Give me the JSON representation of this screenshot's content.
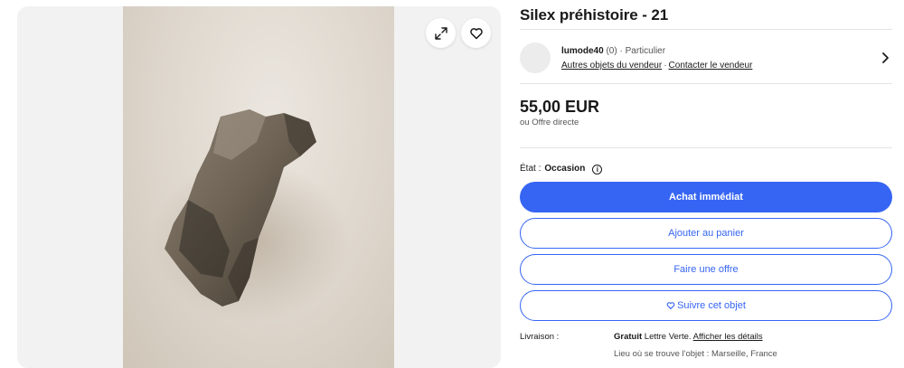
{
  "listing": {
    "title": "Silex préhistoire - 21"
  },
  "seller": {
    "name": "lumode40",
    "feedback": "(0)",
    "type_sep": " · ",
    "type": "Particulier",
    "other_items_link": "Autres objets du vendeur",
    "link_sep": "·",
    "contact_link": "Contacter le vendeur"
  },
  "price": {
    "amount": "55,00 EUR",
    "offer_note": "ou Offre directe"
  },
  "condition": {
    "label": "État :",
    "value": "Occasion"
  },
  "buttons": {
    "buy_now": "Achat immédiat",
    "add_to_cart": "Ajouter au panier",
    "make_offer": "Faire une offre",
    "watch": "Suivre cet objet"
  },
  "shipping": {
    "label": "Livraison :",
    "free": "Gratuit",
    "method": " Lettre Verte. ",
    "details_link": "Afficher les détails",
    "location": "Lieu où se trouve l'objet : Marseille, France"
  },
  "icons": {
    "expand": "expand-icon",
    "heart": "heart-icon",
    "chevron": "chevron-right-icon",
    "info": "info-icon"
  },
  "colors": {
    "accent": "#3665f3",
    "text": "#191919",
    "gallery_bg": "#f2f2f2"
  }
}
